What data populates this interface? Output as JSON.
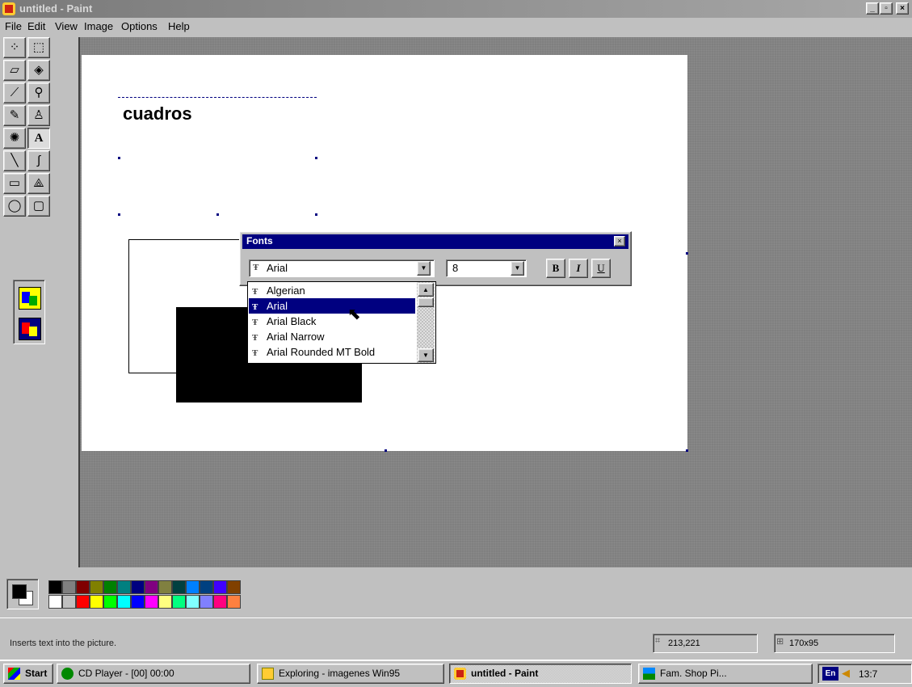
{
  "window": {
    "title": "untitled - Paint",
    "min": "_",
    "max": "▫",
    "close": "×"
  },
  "menu": {
    "items": [
      "File",
      "Edit",
      "View",
      "Image",
      "Options",
      "Help"
    ]
  },
  "canvas": {
    "text": "cuadros"
  },
  "fonts_toolbar": {
    "title": "Fonts",
    "close": "×",
    "font_value": "Arial",
    "size_value": "8",
    "bold": "B",
    "italic": "I",
    "underline": "U",
    "tt_icon": "Ŧ",
    "font_options": [
      {
        "label": "Algerian",
        "selected": false
      },
      {
        "label": "Arial",
        "selected": true
      },
      {
        "label": "Arial Black",
        "selected": false
      },
      {
        "label": "Arial Narrow",
        "selected": false
      },
      {
        "label": "Arial Rounded MT Bold",
        "selected": false
      }
    ]
  },
  "colors": {
    "foreground": "#000000",
    "background": "#ffffff",
    "row1": [
      "#000000",
      "#808080",
      "#800000",
      "#808000",
      "#008000",
      "#008080",
      "#000080",
      "#800080",
      "#808040",
      "#004040",
      "#0080ff",
      "#004080",
      "#4000ff",
      "#804000"
    ],
    "row2": [
      "#ffffff",
      "#c0c0c0",
      "#ff0000",
      "#ffff00",
      "#00ff00",
      "#00ffff",
      "#0000ff",
      "#ff00ff",
      "#ffff80",
      "#00ff80",
      "#80ffff",
      "#8080ff",
      "#ff0080",
      "#ff8040"
    ]
  },
  "status": {
    "help_text": "Inserts text into the picture.",
    "coords": "213,221",
    "size": "170x95"
  },
  "taskbar": {
    "start": "Start",
    "tasks": [
      {
        "label": "CD Player - [00] 00:00",
        "active": false
      },
      {
        "label": "Exploring - imagenes Win95",
        "active": false
      },
      {
        "label": "untitled - Paint",
        "active": true
      },
      {
        "label": "Fam. Shop Pi...",
        "active": false
      }
    ],
    "lang": "En",
    "clock": "13:7"
  }
}
